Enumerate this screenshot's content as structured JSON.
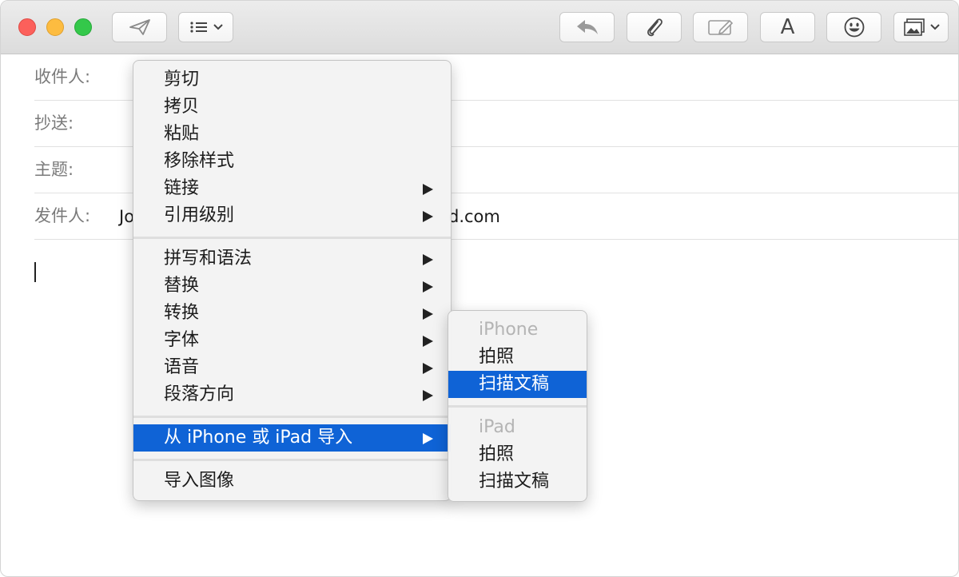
{
  "fields": {
    "to_label": "收件人:",
    "cc_label": "抄送:",
    "subject_label": "主题:",
    "from_label": "发件人:",
    "from_value_start": "Jo",
    "from_value_end": "d.com"
  },
  "toolbar": {
    "icons": [
      "send-icon",
      "list-format-icon",
      "reply-icon",
      "attachment-icon",
      "markup-icon",
      "font-icon",
      "emoji-icon",
      "photo-browser-icon"
    ],
    "font_button_label": "A"
  },
  "context_menu": {
    "cut": "剪切",
    "copy": "拷贝",
    "paste": "粘贴",
    "remove_style": "移除样式",
    "link": "链接",
    "quote_level": "引用级别",
    "spelling_grammar": "拼写和语法",
    "substitutions": "替换",
    "transformations": "转换",
    "font": "字体",
    "speech": "语音",
    "paragraph_direction": "段落方向",
    "import_from_device": "从 iPhone 或 iPad 导入",
    "import_image": "导入图像"
  },
  "submenu": {
    "iphone_header": "iPhone",
    "iphone_take_photo": "拍照",
    "iphone_scan_document": "扫描文稿",
    "ipad_header": "iPad",
    "ipad_take_photo": "拍照",
    "ipad_scan_document": "扫描文稿"
  },
  "colors": {
    "highlight": "#0f63d6",
    "close": "#fc605b",
    "minimize": "#fdbc40",
    "zoom": "#34c84a"
  }
}
